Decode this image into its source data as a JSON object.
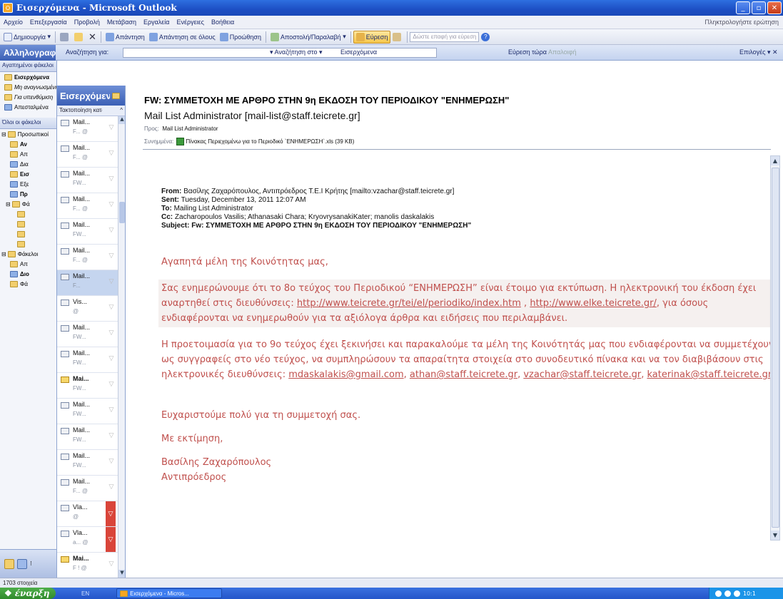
{
  "window": {
    "title": "Εισερχόμενα - Microsoft Outlook"
  },
  "menu": {
    "items": [
      "Αρχείο",
      "Επεξεργασία",
      "Προβολή",
      "Μετάβαση",
      "Εργαλεία",
      "Ενέργειες",
      "Βοήθεια"
    ],
    "help_placeholder": "Πληκτρολογήστε ερώτηση"
  },
  "toolbar": {
    "new": "Δημιουργία",
    "reply": "Απάντηση",
    "reply_all": "Απάντηση σε όλους",
    "forward": "Προώθηση",
    "send_receive": "Αποστολή/Παραλαβή",
    "find": "Εύρεση",
    "contact_search": "Δώστε επαφή για εύρεση"
  },
  "findbar": {
    "nav_title": "Αλληλογραφία",
    "search_label": "Αναζήτηση για:",
    "search_in_label": "Αναζήτηση στο",
    "search_in_value": "Εισερχόμενα",
    "find_now": "Εύρεση τώρα",
    "clear": "Απαλοιφή",
    "options": "Επιλογές"
  },
  "nav": {
    "favorites_header": "Αγαπημένοι φάκελοι",
    "favorites": [
      "Εισερχόμενα",
      "Μη αναγνωσμένη",
      "Για υπενθύμιση",
      "Απεσταλμένα"
    ],
    "all_folders_header": "Όλοι οι φάκελοι",
    "tree": [
      "Προσωπικοί",
      "Αν",
      "Απ",
      "Δια",
      "Εισ",
      "Εξε",
      "Πρ",
      "Φά"
    ],
    "tree2": [
      "Φάκελοι",
      "Απ",
      "Διο",
      "Φά"
    ]
  },
  "list": {
    "title": "Εισερχόμενα",
    "sort_label": "Τακτοποίηση κατά",
    "messages": [
      {
        "sender": "Mail...",
        "preview": "F... @",
        "flagged": false,
        "bold": false,
        "selected": false,
        "unread": false
      },
      {
        "sender": "Mail...",
        "preview": "F... @",
        "flagged": false,
        "bold": false,
        "selected": false,
        "unread": false
      },
      {
        "sender": "Mail...",
        "preview": "FW...",
        "flagged": false,
        "bold": false,
        "selected": false,
        "unread": false
      },
      {
        "sender": "Mail...",
        "preview": "F... @",
        "flagged": false,
        "bold": false,
        "selected": false,
        "unread": false
      },
      {
        "sender": "Mail...",
        "preview": "FW...",
        "flagged": false,
        "bold": false,
        "selected": false,
        "unread": false
      },
      {
        "sender": "Mail...",
        "preview": "F... @",
        "flagged": false,
        "bold": false,
        "selected": false,
        "unread": false
      },
      {
        "sender": "Mail...",
        "preview": "F...",
        "flagged": false,
        "bold": false,
        "selected": true,
        "unread": false
      },
      {
        "sender": "Vis...",
        "preview": "@",
        "flagged": false,
        "bold": false,
        "selected": false,
        "unread": false
      },
      {
        "sender": "Mail...",
        "preview": "FW...",
        "flagged": false,
        "bold": false,
        "selected": false,
        "unread": false
      },
      {
        "sender": "Mail...",
        "preview": "FW...",
        "flagged": false,
        "bold": false,
        "selected": false,
        "unread": false
      },
      {
        "sender": "Mai...",
        "preview": "FW...",
        "flagged": false,
        "bold": true,
        "selected": false,
        "unread": true
      },
      {
        "sender": "Mail...",
        "preview": "FW...",
        "flagged": false,
        "bold": false,
        "selected": false,
        "unread": false
      },
      {
        "sender": "Mail...",
        "preview": "FW...",
        "flagged": false,
        "bold": false,
        "selected": false,
        "unread": false
      },
      {
        "sender": "Mail...",
        "preview": "FW...",
        "flagged": false,
        "bold": false,
        "selected": false,
        "unread": false
      },
      {
        "sender": "Mail...",
        "preview": "F... @",
        "flagged": false,
        "bold": false,
        "selected": false,
        "unread": false
      },
      {
        "sender": "Vla...",
        "preview": "@",
        "flagged": true,
        "bold": false,
        "selected": false,
        "unread": false
      },
      {
        "sender": "Vla...",
        "preview": "a... @",
        "flagged": true,
        "bold": false,
        "selected": false,
        "unread": false
      },
      {
        "sender": "Mai...",
        "preview": "F ! @",
        "flagged": false,
        "bold": true,
        "selected": false,
        "unread": true
      }
    ]
  },
  "email": {
    "subject": "FW: ΣΥΜΜΕΤΟΧΗ ΜΕ ΑΡΘΡΟ ΣΤΗΝ 9η ΕΚΔΟΣΗ ΤΟΥ ΠΕΡΙΟΔΙΚΟΥ \"ΕΝΗΜΕΡΩΣΗ\"",
    "from": "Mail List Administrator [mail-list@staff.teicrete.gr]",
    "to_label": "Προς:",
    "to": "Mail List Administrator",
    "attach_label": "Συνημμένα:",
    "attachment": "Πίνακας Περιεχομένω για το Περιοδικό `ΕΝΗΜΕΡΩΣΗ`.xls (39 KB)",
    "orig_from_label": "From:",
    "orig_from": "Βασίλης Ζαχαρόπουλος, Αντιπρόεδρος Τ.Ε.Ι Κρήτης [mailto:vzachar@staff.teicrete.gr]",
    "sent_label": "Sent:",
    "sent": "Tuesday, December 13, 2011 12:07 AM",
    "orig_to_label": "To:",
    "orig_to": "Mailing List Administrator",
    "cc_label": "Cc:",
    "cc": "Zacharopoulos Vasilis; Athanasaki Chara; KryovrysanakiKater; manolis daskalakis",
    "subj_label": "Subject:",
    "subj": "Fw: ΣΥΜΜΕΤΟΧΗ ΜΕ ΑΡΘΡΟ ΣΤΗΝ 9η ΕΚΔΟΣΗ ΤΟΥ ΠΕΡΙΟΔΙΚΟΥ \"ΕΝΗΜΕΡΩΣΗ\"",
    "greeting": "Αγαπητά μέλη της Κοινότητας μας,",
    "p1_a": "Σας ενημερώνουμε ότι το 8ο τεύχος του Περιοδικού “ΕΝΗΜΕΡΩΣΗ” είναι έτοιμο για εκτύπωση. Η ηλεκτρονική του έκδοση έχει αναρτηθεί στις διευθύνσεις:",
    "link1": "http://www.teicrete.gr/tei/el/periodiko/index.htm",
    "p1_sep": ",",
    "link2": "http://www.elke.teicrete.gr/",
    "p1_b": ", για όσους ενδιαφέρονται να ενημερωθούν για τα αξιόλογα άρθρα και ειδήσεις που περιλαμβάνει.",
    "p2_a": "Η προετοιμασία για το 9ο τεύχος έχει ξεκινήσει και παρακαλούμε τα μέλη της Κοινότητάς μας που ενδιαφέρονται να συμμετέχουν ως συγγραφείς στο νέο τεύχος, να συμπληρώσουν τα απαραίτητα στοιχεία στο συνοδευτικό πίνακα και να τον διαβιβάσουν στις ηλεκτρονικές διευθύνσεις:",
    "mail1": "mdaskalakis@gmail.com",
    "mail2": "athan@staff.teicrete.gr",
    "mail3": "vzachar@staff.teicrete.gr",
    "mail4": "katerinak@staff.teicrete.gr",
    "thanks": "Ευχαριστούμε πολύ για τη συμμετοχή σας.",
    "regards": "Με εκτίμηση,",
    "sig_name": "Βασίλης Ζαχαρόπουλος",
    "sig_title": "Αντιπρόεδρος"
  },
  "status": {
    "items": "1703 στοιχεία"
  },
  "taskbar": {
    "start": "έναρξη",
    "lang": "EN",
    "task": "Εισερχόμενα - Micros...",
    "clock": "10:1"
  },
  "colors": {
    "body_text": "#c0504d",
    "title_bar": "#2455c9",
    "flag": "#d9453a"
  }
}
